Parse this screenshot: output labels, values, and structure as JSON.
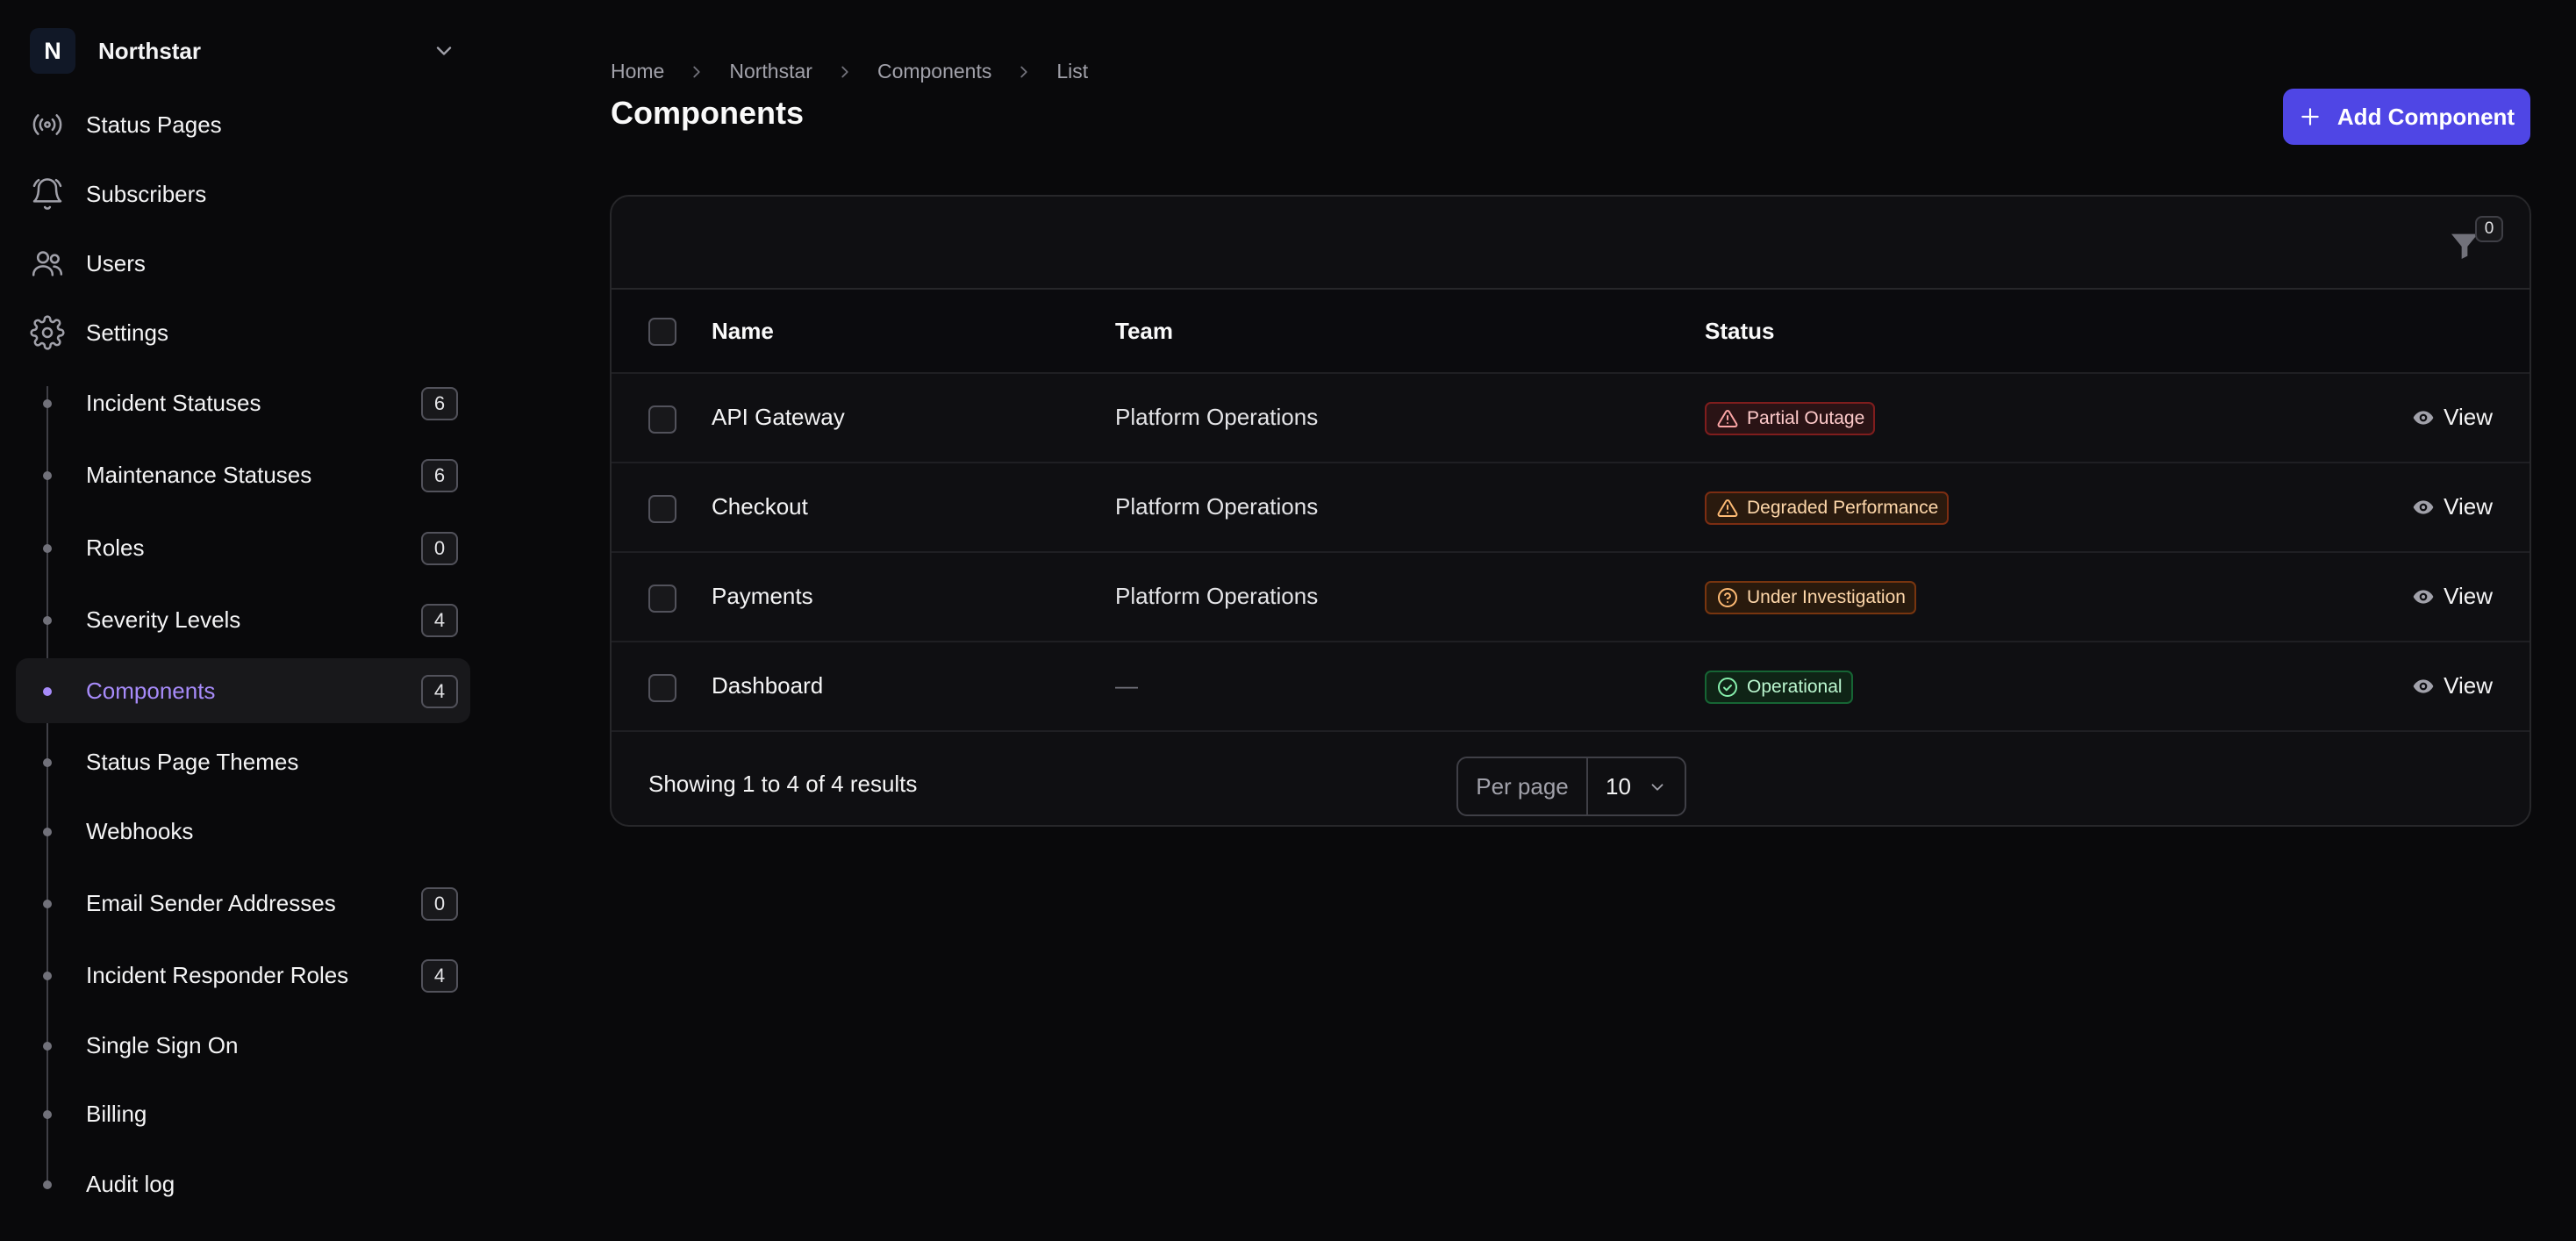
{
  "tenant": {
    "initial": "N",
    "name": "Northstar"
  },
  "nav": [
    {
      "label": "Status Pages",
      "icon": "signal-icon"
    },
    {
      "label": "Subscribers",
      "icon": "bell-icon"
    },
    {
      "label": "Users",
      "icon": "users-icon"
    },
    {
      "label": "Settings",
      "icon": "gear-icon"
    }
  ],
  "subnav": [
    {
      "label": "Incident Statuses",
      "badge": "6"
    },
    {
      "label": "Maintenance Statuses",
      "badge": "6"
    },
    {
      "label": "Roles",
      "badge": "0"
    },
    {
      "label": "Severity Levels",
      "badge": "4"
    },
    {
      "label": "Components",
      "badge": "4",
      "active": true
    },
    {
      "label": "Status Page Themes"
    },
    {
      "label": "Webhooks"
    },
    {
      "label": "Email Sender Addresses",
      "badge": "0"
    },
    {
      "label": "Incident Responder Roles",
      "badge": "4"
    },
    {
      "label": "Single Sign On"
    },
    {
      "label": "Billing"
    },
    {
      "label": "Audit log"
    }
  ],
  "breadcrumb": [
    "Home",
    "Northstar",
    "Components",
    "List"
  ],
  "page_title": "Components",
  "add_button": "Add Component",
  "filter_count": "0",
  "table": {
    "headers": {
      "name": "Name",
      "team": "Team",
      "status": "Status"
    },
    "rows": [
      {
        "name": "API Gateway",
        "team": "Platform Operations",
        "status": "Partial Outage",
        "status_kind": "outage",
        "action": "View"
      },
      {
        "name": "Checkout",
        "team": "Platform Operations",
        "status": "Degraded Performance",
        "status_kind": "degraded",
        "action": "View"
      },
      {
        "name": "Payments",
        "team": "Platform Operations",
        "status": "Under Investigation",
        "status_kind": "investigating",
        "action": "View"
      },
      {
        "name": "Dashboard",
        "team": "—",
        "status": "Operational",
        "status_kind": "operational",
        "action": "View"
      }
    ]
  },
  "footer": {
    "results": "Showing 1 to 4 of 4 results",
    "per_page_label": "Per page",
    "per_page_value": "10"
  },
  "colors": {
    "accent": "#4f46e5",
    "active_nav": "#a78bfa",
    "outage": "#f87171",
    "degraded": "#fb923c",
    "investigating": "#fdba74",
    "operational": "#86efac"
  }
}
